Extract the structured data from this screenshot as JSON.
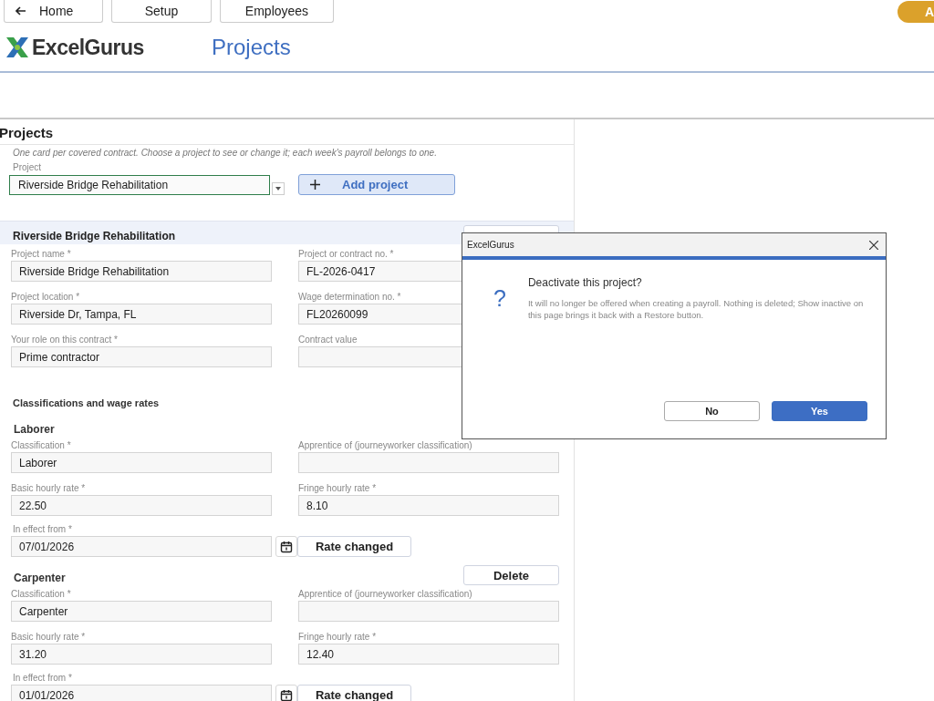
{
  "nav": {
    "buttons": [
      {
        "label": "Home",
        "kind": "back"
      },
      {
        "label": "Setup",
        "kind": "plain"
      },
      {
        "label": "Employees",
        "kind": "plain"
      }
    ],
    "user_badge": "A"
  },
  "brand": "ExcelGurus",
  "page_title": "Projects",
  "section": {
    "title": "Projects",
    "hint": "One card per covered contract. Choose a project to see or change it; each week's payroll belongs to one.",
    "picker": {
      "label": "Project",
      "value": "Riverside Bridge Rehabilitation",
      "focused": true
    },
    "add_button": "Add project"
  },
  "card": {
    "title": "Riverside Bridge Rehabilitation",
    "fields": [
      {
        "label": "Project name *",
        "value": "Riverside Bridge Rehabilitation"
      },
      {
        "label": "Project or contract no. *",
        "value": "FL-2026-0417"
      },
      {
        "label": "Project location *",
        "value": "Riverside Dr, Tampa, FL"
      },
      {
        "label": "Wage determination no. *",
        "value": "FL20260099"
      },
      {
        "label": "Your role on this contract *",
        "value": "Prime contractor"
      },
      {
        "label": "Contract value"
      }
    ]
  },
  "classifications": {
    "heading": "Classifications and wage rates",
    "items": [
      {
        "name": "Laborer",
        "fields": [
          {
            "label": "Classification *",
            "value": "Laborer"
          },
          {
            "label": "Apprentice of (journeyworker classification)"
          },
          {
            "label": "Basic hourly rate *",
            "value": "22.50"
          },
          {
            "label": "Fringe hourly rate *",
            "value": "8.10"
          }
        ],
        "effective": {
          "label": "In effect from *",
          "value": "07/01/2026"
        },
        "rate_button": "Rate changed"
      },
      {
        "name": "Carpenter",
        "delete_button": "Delete",
        "fields": [
          {
            "label": "Classification *",
            "value": "Carpenter"
          },
          {
            "label": "Apprentice of (journeyworker classification)"
          },
          {
            "label": "Basic hourly rate *",
            "value": "31.20"
          },
          {
            "label": "Fringe hourly rate *",
            "value": "12.40"
          }
        ],
        "effective": {
          "label": "In effect from *",
          "value": "01/01/2026"
        },
        "rate_button": "Rate changed"
      }
    ]
  },
  "dialog": {
    "title": "ExcelGurus",
    "heading": "Deactivate this project?",
    "message": "It will no longer be offered when creating a payroll. Nothing is deleted; Show inactive on this page brings it back with a Restore button.",
    "icon": "?",
    "buttons": [
      {
        "label": "No",
        "primary": false
      },
      {
        "label": "Yes",
        "primary": true
      }
    ]
  }
}
